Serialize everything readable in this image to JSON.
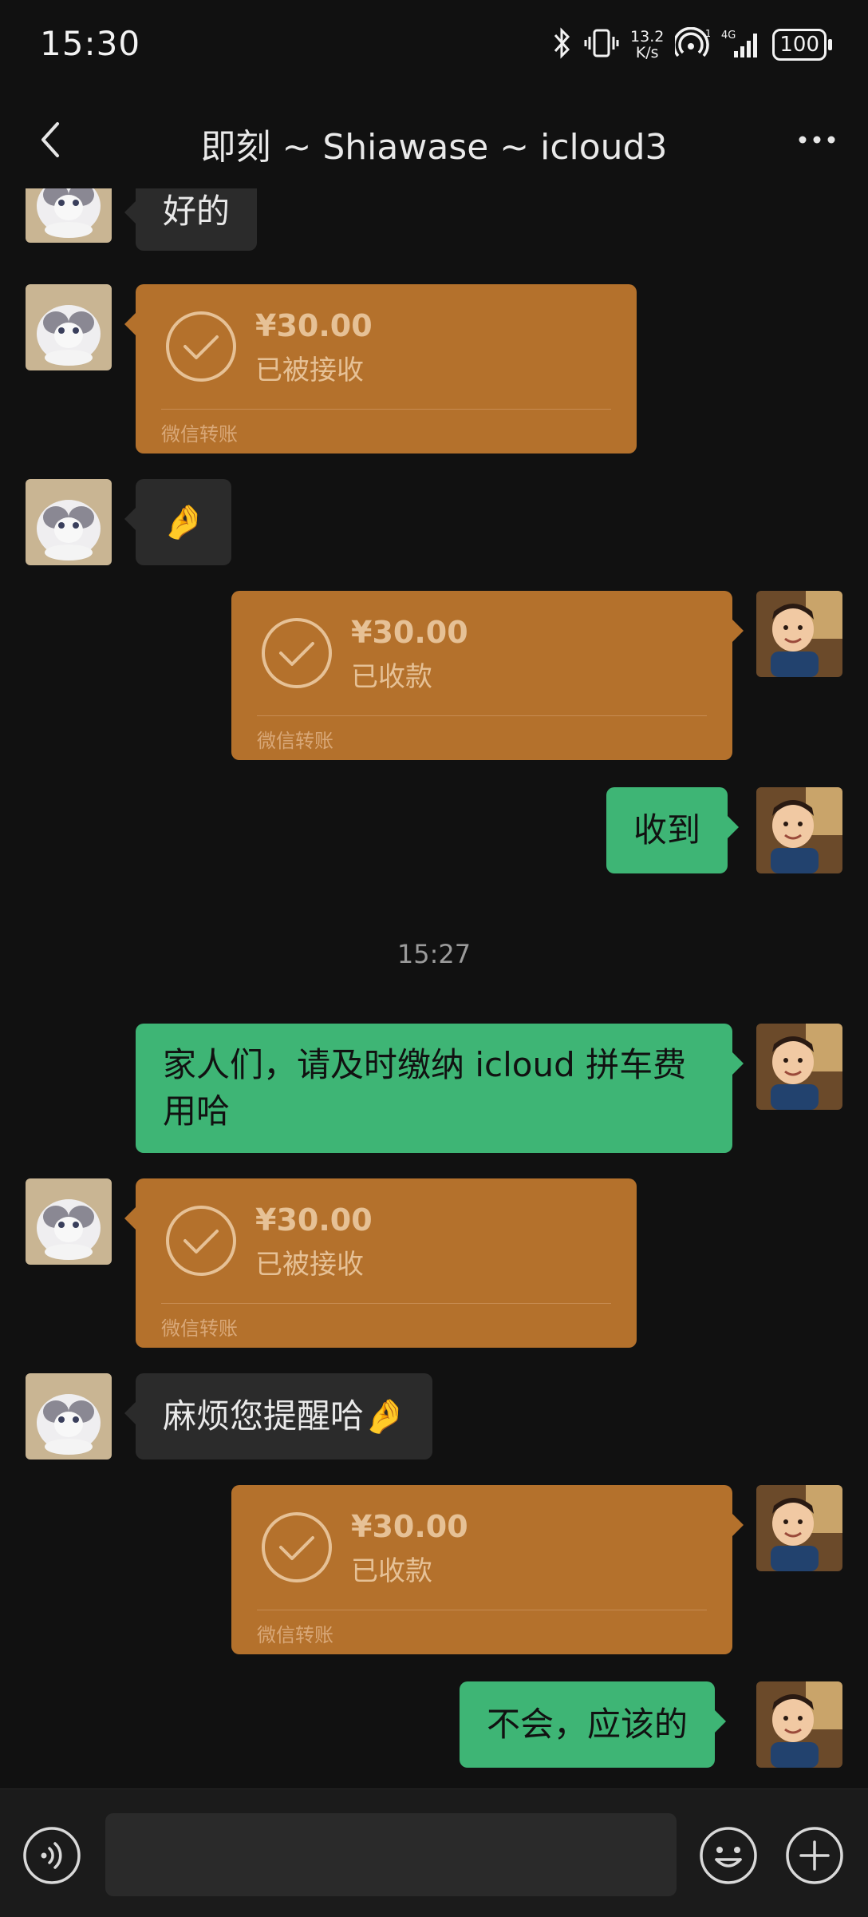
{
  "status_bar": {
    "time": "15:30",
    "net_speed_top": "13.2",
    "net_speed_bottom": "K/s",
    "network_type": "4G",
    "battery": "100",
    "icons": [
      "bluetooth-icon",
      "vibrate-icon",
      "hotspot-icon",
      "signal-icon",
      "battery-icon"
    ]
  },
  "nav": {
    "title": "即刻 ~ Shiawase ~ icloud3",
    "icons": [
      "back-chevron-icon",
      "more-dots-icon"
    ]
  },
  "messages": [
    {
      "side": "left",
      "type": "text",
      "text": "好的"
    },
    {
      "side": "left",
      "type": "transfer",
      "amount": "¥30.00",
      "status": "已被接收",
      "label": "微信转账"
    },
    {
      "side": "left",
      "type": "emoji",
      "text": "🤌"
    },
    {
      "side": "right",
      "type": "transfer",
      "amount": "¥30.00",
      "status": "已收款",
      "label": "微信转账"
    },
    {
      "side": "right",
      "type": "text",
      "text": "收到"
    },
    {
      "type": "timestamp",
      "text": "15:27"
    },
    {
      "side": "right",
      "type": "text",
      "text": "家人们，请及时缴纳 icloud 拼车费用哈"
    },
    {
      "side": "left",
      "type": "transfer",
      "amount": "¥30.00",
      "status": "已被接收",
      "label": "微信转账"
    },
    {
      "side": "left",
      "type": "text",
      "text": "麻烦您提醒哈🤌"
    },
    {
      "side": "right",
      "type": "transfer",
      "amount": "¥30.00",
      "status": "已收款",
      "label": "微信转账"
    },
    {
      "side": "right",
      "type": "text",
      "text": "不会，应该的"
    }
  ],
  "input_bar": {
    "placeholder": "",
    "icons": [
      "voice-icon",
      "emoji-icon",
      "plus-icon"
    ]
  },
  "colors": {
    "background": "#111111",
    "incoming_bubble": "#2b2b2b",
    "outgoing_bubble": "#3eb575",
    "transfer_card": "#b4712c",
    "transfer_text": "#e6c196"
  }
}
